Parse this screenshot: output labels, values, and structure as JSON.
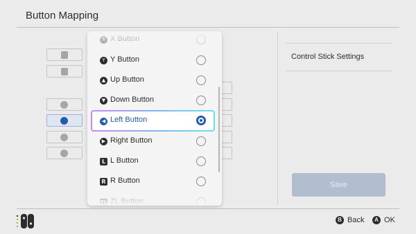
{
  "header": {
    "title": "Button Mapping"
  },
  "right_panel": {
    "setting_label": "Control Stick Settings",
    "save_label": "Save"
  },
  "dropdown": {
    "selected_index": 4,
    "items": [
      {
        "label": "X Button",
        "icon": "X",
        "icon_name": "x-button-icon",
        "state": "faded"
      },
      {
        "label": "Y Button",
        "icon": "Y",
        "icon_name": "y-button-icon",
        "state": "normal"
      },
      {
        "label": "Up Button",
        "icon": "▲",
        "icon_name": "up-button-icon",
        "state": "normal"
      },
      {
        "label": "Down Button",
        "icon": "▼",
        "icon_name": "down-button-icon",
        "state": "normal"
      },
      {
        "label": "Left Button",
        "icon": "◀",
        "icon_name": "left-button-icon",
        "state": "selected"
      },
      {
        "label": "Right Button",
        "icon": "▶",
        "icon_name": "right-button-icon",
        "state": "normal"
      },
      {
        "label": "L Button",
        "icon": "L",
        "icon_name": "l-button-icon",
        "state": "normal"
      },
      {
        "label": "R Button",
        "icon": "R",
        "icon_name": "r-button-icon",
        "state": "normal"
      },
      {
        "label": "ZL Button",
        "icon": "ZL",
        "icon_name": "zl-button-icon",
        "state": "faded"
      }
    ]
  },
  "footer": {
    "back": {
      "glyph": "B",
      "label": "Back"
    },
    "ok": {
      "glyph": "A",
      "label": "OK"
    }
  },
  "colors": {
    "accent": "#235ca8",
    "background": "#ebebeb"
  }
}
